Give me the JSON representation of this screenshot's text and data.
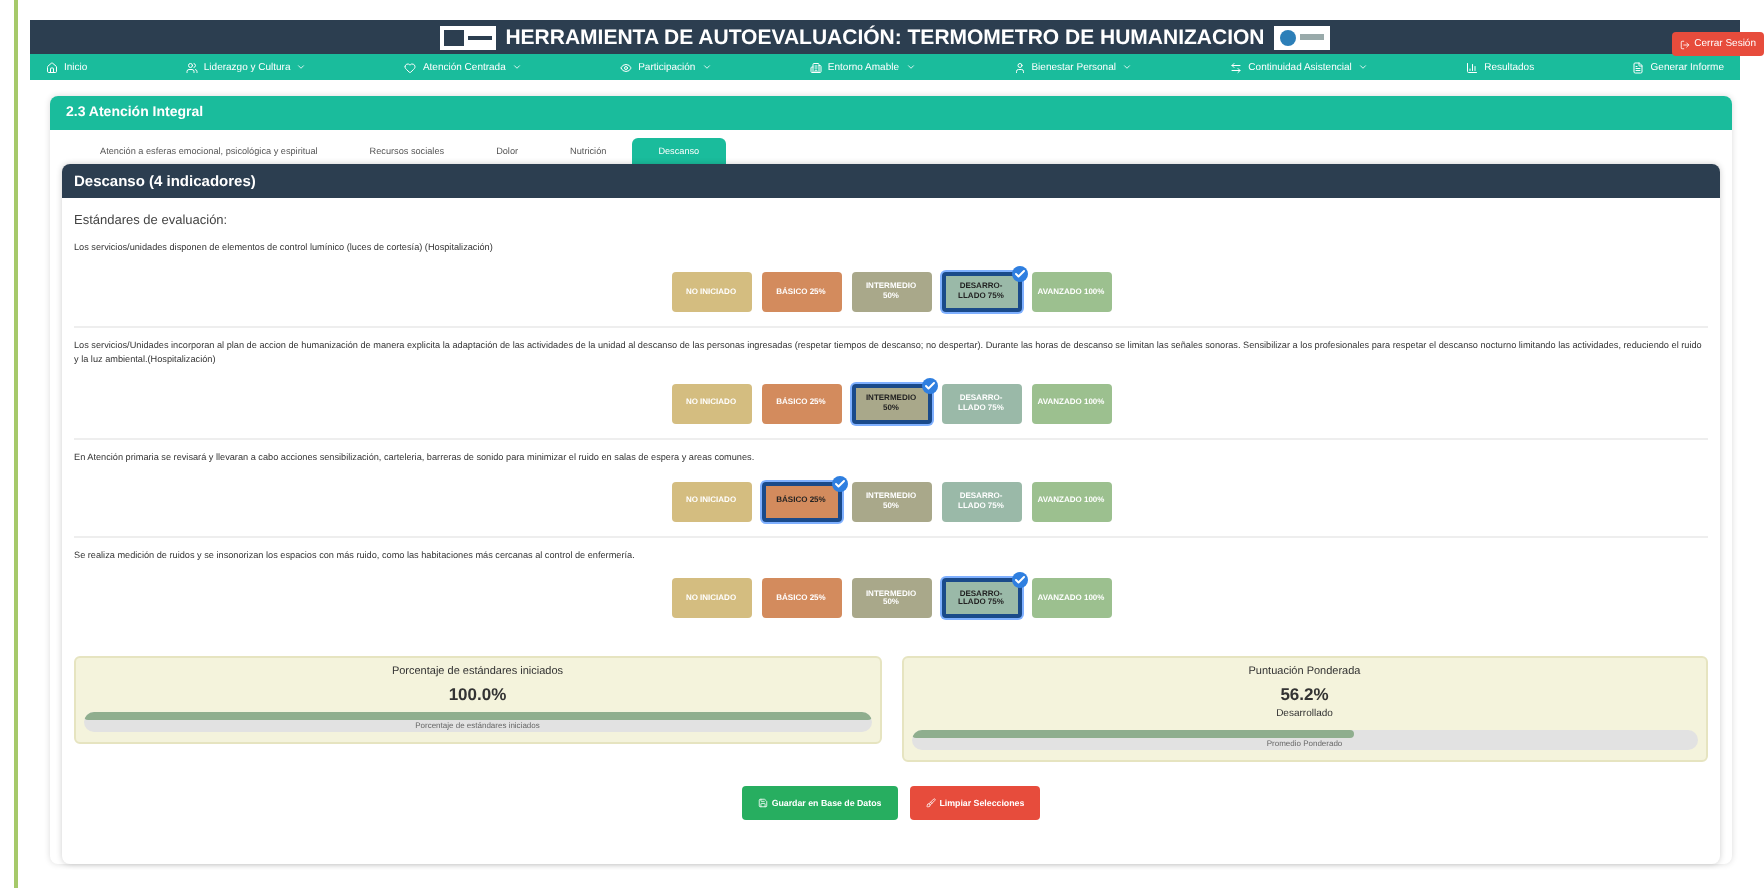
{
  "header": {
    "title": "HERRAMIENTA DE AUTOEVALUACIÓN: TERMOMETRO DE HUMANIZACION",
    "logout": "Cerrar Sesión"
  },
  "nav": [
    {
      "label": "Inicio",
      "dropdown": false
    },
    {
      "label": "Liderazgo y Cultura",
      "dropdown": true
    },
    {
      "label": "Atención Centrada",
      "dropdown": true
    },
    {
      "label": "Participación",
      "dropdown": true
    },
    {
      "label": "Entorno Amable",
      "dropdown": true
    },
    {
      "label": "Bienestar Personal",
      "dropdown": true
    },
    {
      "label": "Continuidad Asistencial",
      "dropdown": true
    },
    {
      "label": "Resultados",
      "dropdown": false
    },
    {
      "label": "Generar Informe",
      "dropdown": false
    }
  ],
  "section": {
    "title": "2.3 Atención Integral"
  },
  "tabs": [
    {
      "label": "Atención a esferas emocional, psicológica y espiritual",
      "selected": false
    },
    {
      "label": "Recursos sociales",
      "selected": false
    },
    {
      "label": "Dolor",
      "selected": false
    },
    {
      "label": "Nutrición",
      "selected": false
    },
    {
      "label": "Descanso",
      "selected": true
    }
  ],
  "panel": {
    "title": "Descanso (4 indicadores)",
    "subtitle": "Estándares de evaluación:"
  },
  "standards": [
    {
      "text": "Los servicios/unidades disponen de elementos de control lumínico (luces de cortesía) (Hospitalización)",
      "options": [
        {
          "kind": "none",
          "label": "NO INICIADO",
          "selected": false
        },
        {
          "kind": "basic",
          "label": "BÁSICO 25%",
          "selected": false
        },
        {
          "kind": "mid",
          "label": "INTERMEDIO 50%",
          "selected": false
        },
        {
          "kind": "developed",
          "label": "DESARRO-LLADO 75%",
          "selected": true
        },
        {
          "kind": "advanced",
          "label": "AVANZADO 100%",
          "selected": false
        }
      ]
    },
    {
      "text": "Los servicios/Unidades incorporan al plan de accion de humanización de manera explicita la adaptación de las actividades de la unidad al descanso de las personas ingresadas (respetar tiempos de descanso; no despertar). Durante las horas de descanso se limitan las señales sonoras. Sensibilizar a los profesionales para respetar el descanso nocturno limitando las actividades, reduciendo el ruido y la luz ambiental.(Hospitalización)",
      "options": [
        {
          "kind": "none",
          "label": "NO INICIADO",
          "selected": false
        },
        {
          "kind": "basic",
          "label": "BÁSICO 25%",
          "selected": false
        },
        {
          "kind": "mid",
          "label": "INTERMEDIO 50%",
          "selected": true
        },
        {
          "kind": "developed",
          "label": "DESARRO-LLADO 75%",
          "selected": false
        },
        {
          "kind": "advanced",
          "label": "AVANZADO 100%",
          "selected": false
        }
      ]
    },
    {
      "text": "En Atención primaria se revisará y llevaran a cabo acciones sensibilización, carteleria, barreras de sonido para minimizar el ruido en salas de espera y areas comunes.",
      "options": [
        {
          "kind": "none",
          "label": "NO INICIADO",
          "selected": false
        },
        {
          "kind": "basic",
          "label": "BÁSICO 25%",
          "selected": true
        },
        {
          "kind": "mid",
          "label": "INTERMEDIO 50%",
          "selected": false
        },
        {
          "kind": "developed",
          "label": "DESARRO-LLADO 75%",
          "selected": false
        },
        {
          "kind": "advanced",
          "label": "AVANZADO 100%",
          "selected": false
        }
      ]
    },
    {
      "text": "Se realiza medición de ruidos y se insonorizan los espacios con más ruido, como las habitaciones más cercanas al control de enfermería.",
      "options": [
        {
          "kind": "none",
          "label": "NO INICIADO",
          "selected": false
        },
        {
          "kind": "basic",
          "label": "BÁSICO 25%",
          "selected": false
        },
        {
          "kind": "mid",
          "label": "INTERMEDIO 50%",
          "selected": false
        },
        {
          "kind": "developed",
          "label": "DESARRO-LLADO 75%",
          "selected": true
        },
        {
          "kind": "advanced",
          "label": "AVANZADO 100%",
          "selected": false
        }
      ]
    }
  ],
  "stats": [
    {
      "title": "Porcentaje de estándares iniciados",
      "value": "100.0%",
      "level": 1.0,
      "caption": "Porcentaje de estándares iniciados"
    },
    {
      "title": "Puntuación Ponderada",
      "value": "56.2%",
      "status": "Desarrollado",
      "level": 0.562,
      "caption": "Promedio Ponderado"
    }
  ],
  "actions": [
    {
      "kind": "save",
      "label": "Guardar en Base de Datos"
    },
    {
      "kind": "clear",
      "label": "Limpiar Selecciones"
    }
  ]
}
